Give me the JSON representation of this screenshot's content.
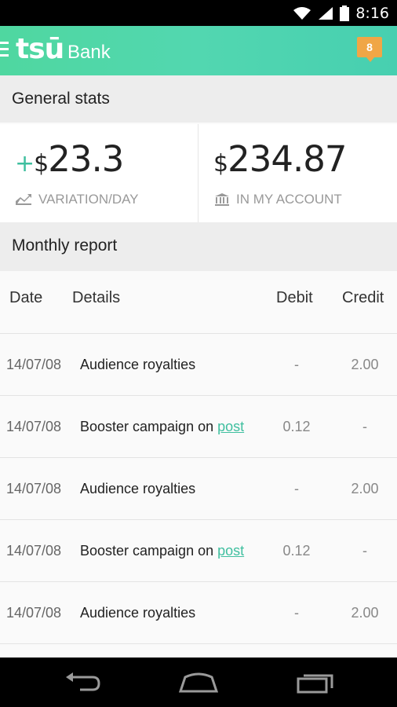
{
  "status_bar": {
    "time": "8:16"
  },
  "app_bar": {
    "logo": "tsū",
    "title": "Bank",
    "notification_count": "8"
  },
  "general_stats": {
    "header": "General stats",
    "variation": {
      "sign": "+",
      "currency": "$",
      "value": "23.3",
      "label": "VARIATION/DAY"
    },
    "account": {
      "currency": "$",
      "value": "234.87",
      "label": "IN MY ACCOUNT"
    }
  },
  "monthly_report": {
    "header": "Monthly report",
    "columns": {
      "date": "Date",
      "details": "Details",
      "debit": "Debit",
      "credit": "Credit"
    },
    "rows": [
      {
        "date": "14/07/08",
        "details": "Audience royalties",
        "link": "",
        "debit": "-",
        "credit": "2.00"
      },
      {
        "date": "14/07/08",
        "details": "Booster campaign on",
        "link": "post",
        "debit": "0.12",
        "credit": "-"
      },
      {
        "date": "14/07/08",
        "details": "Audience royalties",
        "link": "",
        "debit": "-",
        "credit": "2.00"
      },
      {
        "date": "14/07/08",
        "details": "Booster campaign on",
        "link": "post",
        "debit": "0.12",
        "credit": "-"
      },
      {
        "date": "14/07/08",
        "details": "Audience royalties",
        "link": "",
        "debit": "-",
        "credit": "2.00"
      }
    ]
  },
  "colors": {
    "accent": "#4fd7a0",
    "badge": "#f0a646",
    "link": "#3fbf9f"
  },
  "icons": [
    "wifi-icon",
    "signal-icon",
    "battery-icon",
    "menu-icon",
    "chart-icon",
    "bank-icon",
    "back-icon",
    "home-icon",
    "recents-icon"
  ]
}
